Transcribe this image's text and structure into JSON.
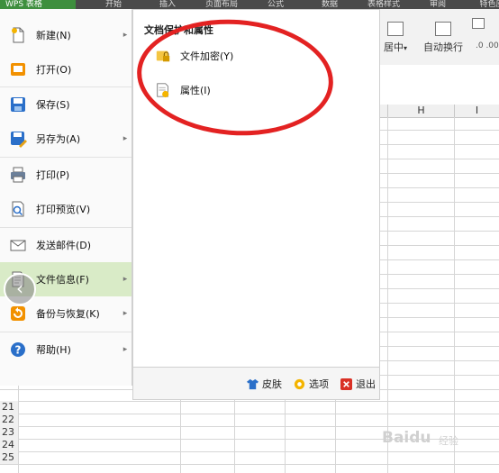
{
  "app": {
    "menu_button_label": "WPS 表格"
  },
  "tabs": [
    "开始",
    "插入",
    "页面布局",
    "公式",
    "数据",
    "表格样式",
    "审阅",
    "特色应"
  ],
  "ribbon": {
    "merge_center_label": "居中",
    "wrap_text_label": "自动换行"
  },
  "file_menu": {
    "items": [
      {
        "id": "new",
        "label": "新建(N)",
        "icon": "new-file-icon",
        "has_submenu": true
      },
      {
        "id": "open",
        "label": "打开(O)",
        "icon": "open-folder-icon",
        "has_submenu": false
      },
      {
        "id": "save",
        "label": "保存(S)",
        "icon": "save-icon",
        "has_submenu": false
      },
      {
        "id": "save-as",
        "label": "另存为(A)",
        "icon": "save-as-icon",
        "has_submenu": true
      },
      {
        "id": "print",
        "label": "打印(P)",
        "icon": "printer-icon",
        "has_submenu": false
      },
      {
        "id": "print-preview",
        "label": "打印预览(V)",
        "icon": "print-preview-icon",
        "has_submenu": false
      },
      {
        "id": "send-mail",
        "label": "发送邮件(D)",
        "icon": "envelope-icon",
        "has_submenu": false
      },
      {
        "id": "file-info",
        "label": "文件信息(F)",
        "icon": "file-info-icon",
        "has_submenu": true,
        "active": true
      },
      {
        "id": "backup",
        "label": "备份与恢复(K)",
        "icon": "backup-icon",
        "has_submenu": true
      },
      {
        "id": "help",
        "label": "帮助(H)",
        "icon": "help-icon",
        "has_submenu": true
      }
    ],
    "submenu": {
      "title": "文档保护和属性",
      "items": [
        {
          "id": "encrypt",
          "label": "文件加密(Y)",
          "icon": "lock-folder-icon"
        },
        {
          "id": "properties",
          "label": "属性(I)",
          "icon": "properties-icon"
        }
      ]
    },
    "footer": {
      "skin_label": "皮肤",
      "options_label": "选项",
      "exit_label": "退出"
    }
  },
  "sheet": {
    "column_headers": [
      "H",
      "I"
    ],
    "row_numbers": [
      "21",
      "22",
      "23",
      "24",
      "25"
    ]
  },
  "watermark": {
    "brand": "Baidu",
    "sub": "经验"
  },
  "colors": {
    "active_menu_bg": "#d9ebc7",
    "annotation": "#e32222",
    "app_green": "#3e8f3e"
  }
}
